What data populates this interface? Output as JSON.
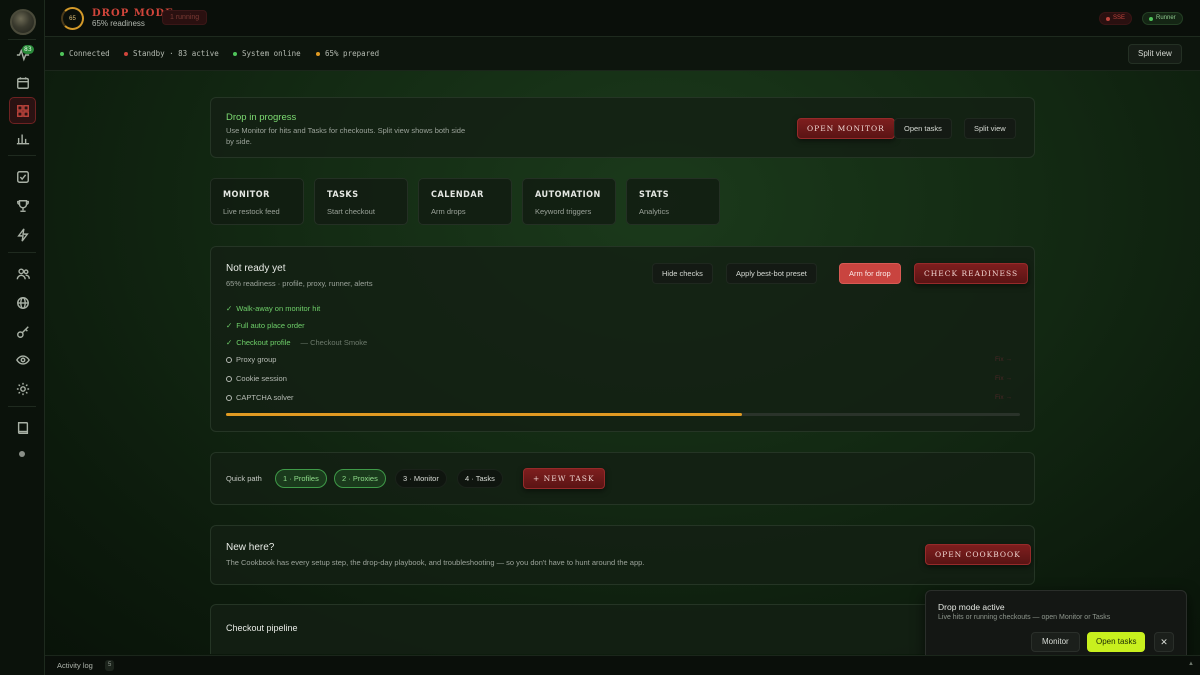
{
  "topbar": {
    "readiness_ring": "65",
    "title": "DROP MODE",
    "subtitle": "65% readiness",
    "running": "1 running",
    "status_red": "SSE",
    "status_green": "Runner"
  },
  "sidebar": {
    "activity_badge": "83",
    "icons": [
      "pulse-icon",
      "calendar-icon",
      "grid-icon",
      "bar-chart-icon",
      "checkbox-icon",
      "trophy-icon",
      "bolt-icon",
      "users-icon",
      "globe-icon",
      "key-icon",
      "eye-icon",
      "gear-icon",
      "book-icon"
    ]
  },
  "strip": {
    "items": [
      {
        "label": "Connected",
        "color": "#4fc45a"
      },
      {
        "label": "Standby · 83 active",
        "color": "#d0453b"
      },
      {
        "label": "System online",
        "color": "#4fc45a"
      },
      {
        "label": "65% prepared",
        "color": "#e09a22"
      }
    ],
    "split_view": "Split view"
  },
  "drop_banner": {
    "title": "Drop in progress",
    "description": "Use Monitor for hits and Tasks for checkouts. Split view shows both side by side.",
    "open_monitor": "OPEN MONITOR",
    "open_tasks": "Open tasks",
    "split_view": "Split view"
  },
  "nav_cards": [
    {
      "title": "MONITOR",
      "subtitle": "Live restock feed"
    },
    {
      "title": "TASKS",
      "subtitle": "Start checkout"
    },
    {
      "title": "CALENDAR",
      "subtitle": "Arm drops"
    },
    {
      "title": "AUTOMATION",
      "subtitle": "Keyword triggers"
    },
    {
      "title": "STATS",
      "subtitle": "Analytics"
    }
  ],
  "readiness": {
    "title": "Not ready yet",
    "subtitle": "65% readiness · profile, proxy, runner, alerts",
    "hide_checks": "Hide checks",
    "apply_preset": "Apply best-bot preset",
    "arm": "Arm for drop",
    "check": "CHECK READINESS",
    "checks": [
      {
        "label": "Walk-away on monitor hit",
        "done": true,
        "mark": "✓"
      },
      {
        "label": "Full auto place order",
        "done": true,
        "mark": "✓"
      },
      {
        "label": "Checkout profile",
        "done": true,
        "mark": "✓",
        "note": "— Checkout Smoke"
      },
      {
        "label": "Proxy group",
        "done": false,
        "fix": "Fix →"
      },
      {
        "label": "Cookie session",
        "done": false,
        "fix": "Fix →"
      },
      {
        "label": "CAPTCHA solver",
        "done": false,
        "fix": "Fix →"
      }
    ],
    "progress": 0.65
  },
  "quick_path": {
    "label": "Quick path",
    "steps": [
      "1 · Profiles",
      "2 · Proxies",
      "3 · Monitor",
      "4 · Tasks"
    ],
    "new_task": "+ NEW TASK"
  },
  "cookbook": {
    "title": "New here?",
    "text": "The Cookbook has every setup step, the drop-day playbook, and troubleshooting — so you don't have to hunt around the app.",
    "button": "OPEN COOKBOOK"
  },
  "pipeline": {
    "title": "Checkout pipeline"
  },
  "toast": {
    "title": "Drop mode active",
    "subtitle": "Live hits or running checkouts — open Monitor or Tasks",
    "monitor": "Monitor",
    "open_tasks": "Open tasks",
    "close": "✕"
  },
  "bottombar": {
    "label": "Activity log",
    "count": "5",
    "caret": "▲"
  }
}
